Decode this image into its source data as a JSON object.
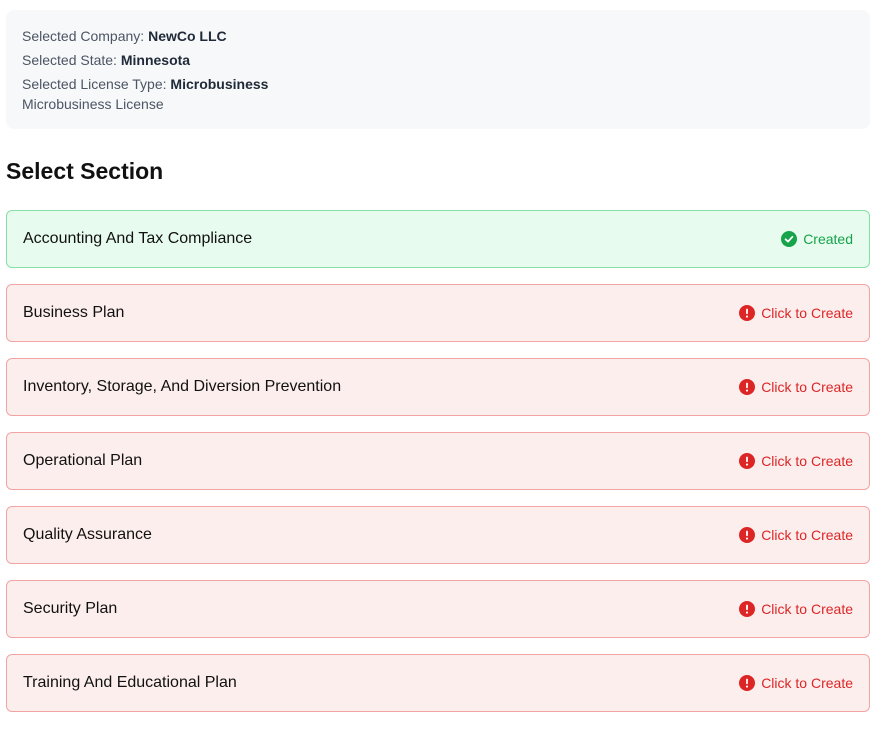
{
  "info": {
    "company_label": "Selected Company:",
    "company_value": "NewCo LLC",
    "state_label": "Selected State:",
    "state_value": "Minnesota",
    "license_label": "Selected License Type:",
    "license_value": "Microbusiness",
    "license_description": "Microbusiness License"
  },
  "heading": "Select Section",
  "sections": [
    {
      "title": "Accounting And Tax Compliance",
      "status": "Created",
      "state": "created",
      "icon": "check-circle-icon"
    },
    {
      "title": "Business Plan",
      "status": "Click to Create",
      "state": "pending",
      "icon": "alert-circle-icon"
    },
    {
      "title": "Inventory, Storage, And Diversion Prevention",
      "status": "Click to Create",
      "state": "pending",
      "icon": "alert-circle-icon"
    },
    {
      "title": "Operational Plan",
      "status": "Click to Create",
      "state": "pending",
      "icon": "alert-circle-icon"
    },
    {
      "title": "Quality Assurance",
      "status": "Click to Create",
      "state": "pending",
      "icon": "alert-circle-icon"
    },
    {
      "title": "Security Plan",
      "status": "Click to Create",
      "state": "pending",
      "icon": "alert-circle-icon"
    },
    {
      "title": "Training And Educational Plan",
      "status": "Click to Create",
      "state": "pending",
      "icon": "alert-circle-icon"
    }
  ],
  "colors": {
    "created_accent": "#16a34a",
    "pending_accent": "#dc2626",
    "created_bg": "#e8fbef",
    "pending_bg": "#fdeeee"
  }
}
